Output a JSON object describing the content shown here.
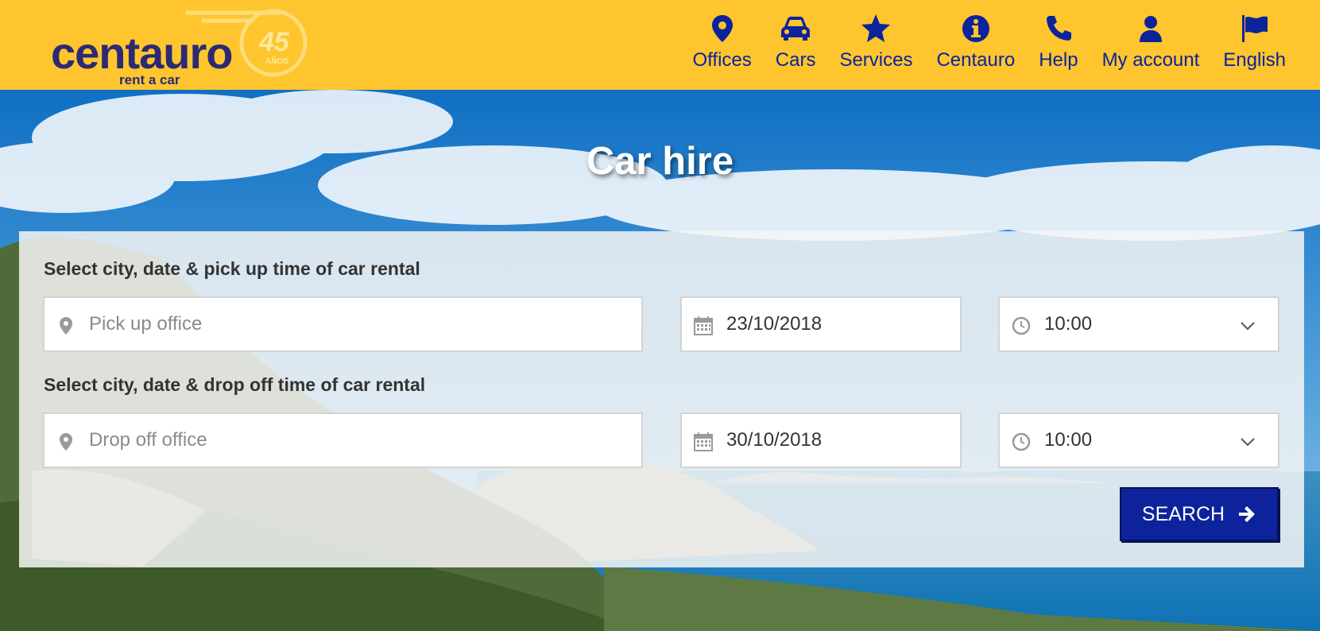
{
  "brand": {
    "name": "centauro",
    "tagline": "rent a car",
    "anniversary_number": "45",
    "anniversary_word": "AÑOS",
    "colors": {
      "header": "#fec52e",
      "primary": "#0c239c",
      "logo": "#2b2a73"
    }
  },
  "nav": {
    "items": [
      {
        "label": "Offices",
        "icon": "map-pin-icon"
      },
      {
        "label": "Cars",
        "icon": "car-icon"
      },
      {
        "label": "Services",
        "icon": "star-icon"
      },
      {
        "label": "Centauro",
        "icon": "info-icon"
      },
      {
        "label": "Help",
        "icon": "phone-icon"
      },
      {
        "label": "My account",
        "icon": "user-icon"
      },
      {
        "label": "English",
        "icon": "flag-icon"
      }
    ]
  },
  "hero": {
    "title": "Car hire"
  },
  "search": {
    "pickup": {
      "label": "Select city, date & pick up time of car rental",
      "office_value": "",
      "office_placeholder": "Pick up office",
      "date": "23/10/2018",
      "time": "10:00"
    },
    "dropoff": {
      "label": "Select city, date & drop off time of car rental",
      "office_value": "",
      "office_placeholder": "Drop off office",
      "date": "30/10/2018",
      "time": "10:00"
    },
    "button_label": "SEARCH"
  }
}
